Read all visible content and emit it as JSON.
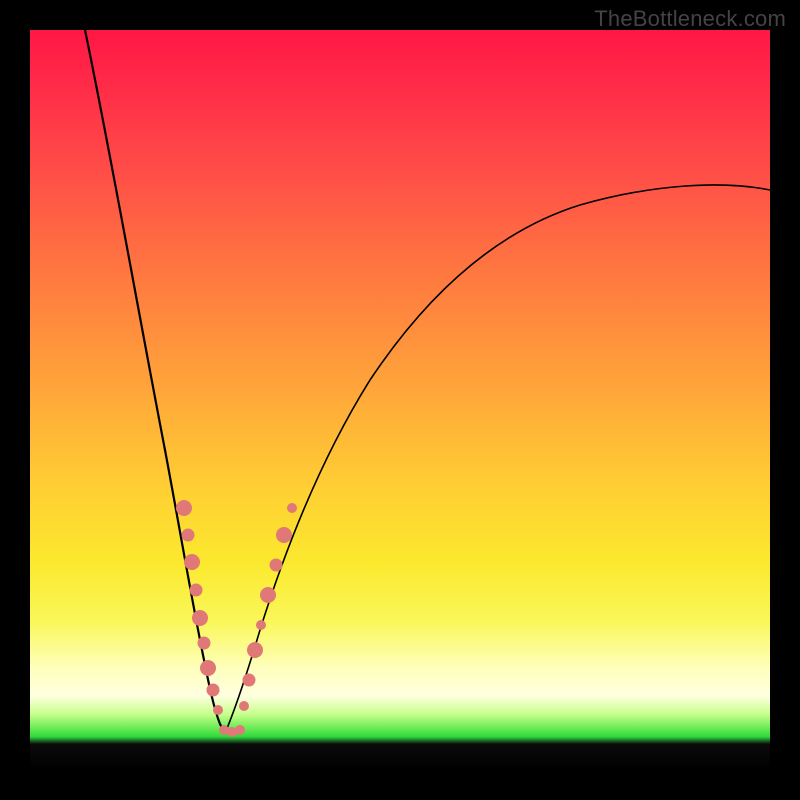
{
  "watermark": "TheBottleneck.com",
  "colors": {
    "gradient_top": "#ff1744",
    "gradient_mid1": "#ff7840",
    "gradient_mid2": "#ffcf33",
    "gradient_pale": "#feffb9",
    "gradient_green": "#2ed93f",
    "gradient_bottom": "#000000",
    "curve": "#000000",
    "marker": "#e07878",
    "frame": "#000000"
  },
  "chart_data": {
    "type": "line",
    "title": "",
    "xlabel": "",
    "ylabel": "",
    "xlim": [
      0,
      100
    ],
    "ylim": [
      0,
      100
    ],
    "grid": false,
    "notes": "V-shaped bottleneck curve; minimum near x≈25 at y≈0. Descending left arm from (8,100) to (25,0); ascending right arm from (25,0) to (100,78). Salmon markers cluster on both arms roughly between y≈8 and y≈32.",
    "series": [
      {
        "name": "curve",
        "x": [
          8,
          12,
          15,
          18,
          20,
          22,
          24,
          25,
          26,
          28,
          30,
          33,
          37,
          42,
          48,
          55,
          63,
          72,
          82,
          91,
          100
        ],
        "y": [
          100,
          82,
          66,
          50,
          37,
          24,
          10,
          0,
          8,
          18,
          27,
          36,
          45,
          53,
          60,
          66,
          70,
          73.5,
          76,
          77.2,
          78
        ]
      },
      {
        "name": "markers-left-arm",
        "x": [
          20.0,
          20.7,
          21.3,
          22.0,
          22.6,
          23.2,
          23.8,
          24.3
        ],
        "y": [
          32,
          28,
          24,
          20,
          16.5,
          13,
          10,
          7
        ]
      },
      {
        "name": "markers-right-arm",
        "x": [
          26.2,
          27.0,
          27.8,
          28.6,
          29.5,
          30.4,
          31.3
        ],
        "y": [
          9,
          13,
          17,
          21,
          25,
          29,
          32
        ]
      }
    ]
  }
}
